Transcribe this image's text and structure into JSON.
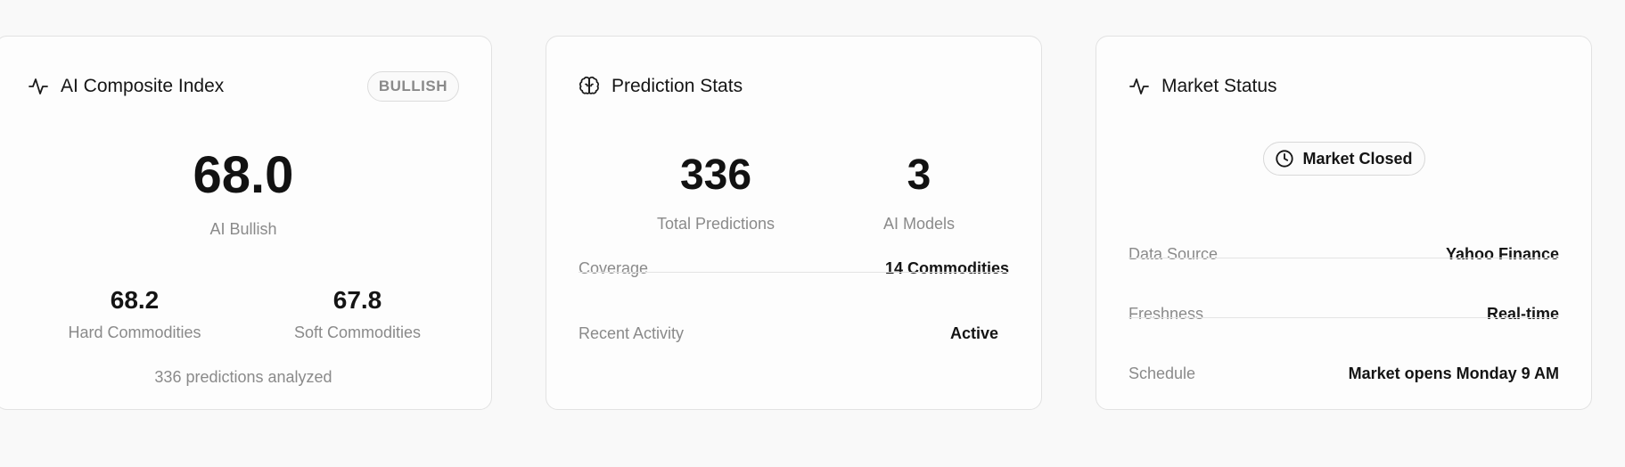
{
  "composite": {
    "title": "AI Composite Index",
    "badge": "BULLISH",
    "value": "68.0",
    "sentiment": "AI Bullish",
    "hard": {
      "value": "68.2",
      "label": "Hard Commodities"
    },
    "soft": {
      "value": "67.8",
      "label": "Soft Commodities"
    },
    "footer": "336 predictions analyzed",
    "icon": "activity-icon"
  },
  "prediction": {
    "title": "Prediction Stats",
    "icon": "brain-icon",
    "total": {
      "value": "336",
      "label": "Total Predictions"
    },
    "models": {
      "value": "3",
      "label": "AI Models"
    },
    "rows": [
      {
        "key": "Coverage",
        "value": "14 Commodities"
      },
      {
        "key": "Recent Activity",
        "value": "Active"
      }
    ]
  },
  "market": {
    "title": "Market Status",
    "icon": "activity-icon",
    "status": "Market Closed",
    "status_icon": "clock-icon",
    "rows": [
      {
        "key": "Data Source",
        "value": "Yahoo Finance"
      },
      {
        "key": "Freshness",
        "value": "Real-time"
      },
      {
        "key": "Schedule",
        "value": "Market opens Monday 9 AM"
      }
    ]
  }
}
